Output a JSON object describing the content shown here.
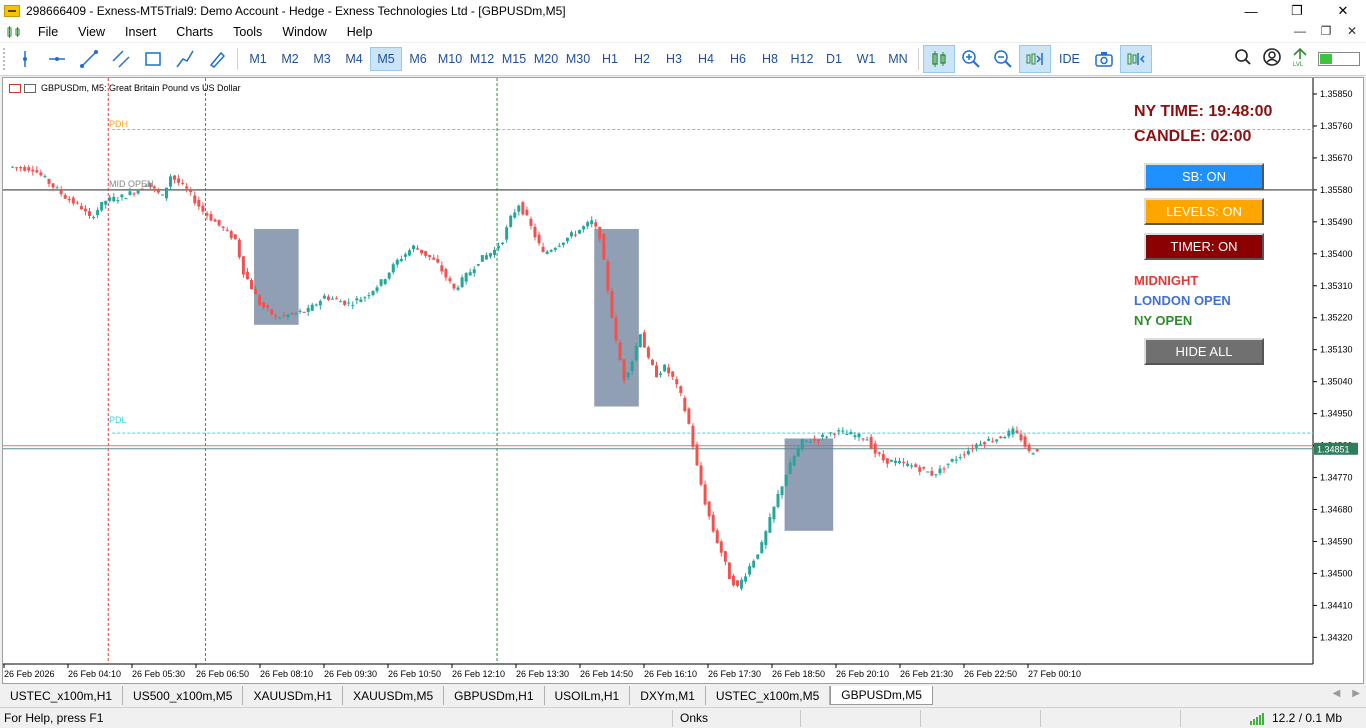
{
  "title_bar": {
    "title": "298666409 - Exness-MT5Trial9: Demo Account - Hedge - Exness Technologies Ltd - [GBPUSDm,M5]",
    "minimize": "—",
    "restore": "❐",
    "close": "✕"
  },
  "menu": {
    "items": [
      "File",
      "View",
      "Insert",
      "Charts",
      "Tools",
      "Window",
      "Help"
    ],
    "right_minimize": "—",
    "right_restore": "❐",
    "right_close": "✕"
  },
  "toolbar": {
    "timeframes": [
      "M1",
      "M2",
      "M3",
      "M4",
      "M5",
      "M6",
      "M10",
      "M12",
      "M15",
      "M20",
      "M30",
      "H1",
      "H2",
      "H3",
      "H4",
      "H6",
      "H8",
      "H12",
      "D1",
      "W1",
      "MN"
    ],
    "active_timeframe": "M5",
    "ide_label": "IDE"
  },
  "chart": {
    "header_text": "GBPUSDm, M5:  Great Britain Pound vs US Dollar",
    "ny_time": "NY TIME: 19:48:00",
    "candle": "CANDLE: 02:00",
    "buttons": {
      "sb": "SB: ON",
      "levels": "LEVELS: ON",
      "timer": "TIMER: ON",
      "hide_all": "HIDE ALL"
    },
    "legend": {
      "midnight": "MIDNIGHT",
      "london_open": "LONDON OPEN",
      "ny_open": "NY OPEN"
    },
    "level_labels": {
      "pdh": "PDH",
      "mid_open": "MID OPEN",
      "pdl": "PDL"
    },
    "current_price": "1.34851",
    "colors": {
      "bull": "#26a69a",
      "bear": "#ef5350",
      "midnight_line": "#e53935",
      "london_line": "#3f6fd8",
      "ny_line": "#2e8b2e",
      "pdh": "#f5a623",
      "pdl": "#33d6e0",
      "zone": "#6b7f99",
      "sb_button": "#1e90ff",
      "levels_button": "#ffa500",
      "timer_button": "#8b0000",
      "hide_button": "#707070"
    }
  },
  "chart_data": {
    "type": "candlestick",
    "symbol": "GBPUSDm",
    "timeframe": "M5",
    "y_ticks": [
      "1.35850",
      "1.35760",
      "1.35670",
      "1.35580",
      "1.35490",
      "1.35400",
      "1.35310",
      "1.35220",
      "1.35130",
      "1.35040",
      "1.34950",
      "1.34860",
      "1.34770",
      "1.34680",
      "1.34590",
      "1.34500",
      "1.34410",
      "1.34320"
    ],
    "ylim": [
      1.34245,
      1.35895
    ],
    "x_ticks": [
      "26 Feb 2026",
      "26 Feb 04:10",
      "26 Feb 05:30",
      "26 Feb 06:50",
      "26 Feb 08:10",
      "26 Feb 09:30",
      "26 Feb 10:50",
      "26 Feb 12:10",
      "26 Feb 13:30",
      "26 Feb 14:50",
      "26 Feb 16:10",
      "26 Feb 17:30",
      "26 Feb 18:50",
      "26 Feb 20:10",
      "26 Feb 21:30",
      "26 Feb 22:50",
      "27 Feb 00:10"
    ],
    "levels": {
      "pdh": 1.3575,
      "mid_open": 1.3558,
      "pdl": 1.34895,
      "current": 1.34851
    },
    "close_path": [
      [
        0,
        1.35645
      ],
      [
        6,
        1.3564
      ],
      [
        10,
        1.356
      ],
      [
        14,
        1.3556
      ],
      [
        18,
        1.3553
      ],
      [
        20,
        1.355
      ],
      [
        24,
        1.3555
      ],
      [
        28,
        1.3556
      ],
      [
        32,
        1.3558
      ],
      [
        34,
        1.356
      ],
      [
        38,
        1.3556
      ],
      [
        40,
        1.3562
      ],
      [
        44,
        1.3558
      ],
      [
        48,
        1.3552
      ],
      [
        52,
        1.3548
      ],
      [
        56,
        1.3544
      ],
      [
        58,
        1.3535
      ],
      [
        62,
        1.3526
      ],
      [
        66,
        1.3522
      ],
      [
        70,
        1.3523
      ],
      [
        74,
        1.3524
      ],
      [
        78,
        1.3528
      ],
      [
        84,
        1.3526
      ],
      [
        88,
        1.3528
      ],
      [
        92,
        1.3532
      ],
      [
        96,
        1.3538
      ],
      [
        100,
        1.3542
      ],
      [
        104,
        1.3539
      ],
      [
        106,
        1.3537
      ],
      [
        110,
        1.353
      ],
      [
        114,
        1.3535
      ],
      [
        116,
        1.3538
      ],
      [
        120,
        1.3541
      ],
      [
        122,
        1.3544
      ],
      [
        124,
        1.355
      ],
      [
        126,
        1.3554
      ],
      [
        128,
        1.355
      ],
      [
        130,
        1.3545
      ],
      [
        132,
        1.354
      ],
      [
        136,
        1.3543
      ],
      [
        140,
        1.3546
      ],
      [
        144,
        1.3549
      ],
      [
        146,
        1.3545
      ],
      [
        148,
        1.353
      ],
      [
        150,
        1.3515
      ],
      [
        152,
        1.3505
      ],
      [
        154,
        1.351
      ],
      [
        156,
        1.3518
      ],
      [
        158,
        1.351
      ],
      [
        160,
        1.3506
      ],
      [
        162,
        1.3508
      ],
      [
        164,
        1.3505
      ],
      [
        166,
        1.35
      ],
      [
        168,
        1.3492
      ],
      [
        170,
        1.348
      ],
      [
        172,
        1.347
      ],
      [
        174,
        1.3462
      ],
      [
        176,
        1.3456
      ],
      [
        178,
        1.3449
      ],
      [
        180,
        1.3446
      ],
      [
        182,
        1.345
      ],
      [
        184,
        1.3454
      ],
      [
        186,
        1.3458
      ],
      [
        188,
        1.3465
      ],
      [
        190,
        1.3472
      ],
      [
        192,
        1.3478
      ],
      [
        194,
        1.3483
      ],
      [
        196,
        1.3487
      ],
      [
        200,
        1.3488
      ],
      [
        204,
        1.349
      ],
      [
        208,
        1.3489
      ],
      [
        212,
        1.3488
      ],
      [
        214,
        1.3484
      ],
      [
        216,
        1.3482
      ],
      [
        220,
        1.3481
      ],
      [
        224,
        1.348
      ],
      [
        228,
        1.3478
      ],
      [
        230,
        1.3479
      ],
      [
        232,
        1.3481
      ],
      [
        236,
        1.3484
      ],
      [
        240,
        1.3487
      ],
      [
        244,
        1.3488
      ],
      [
        248,
        1.349
      ],
      [
        250,
        1.3488
      ],
      [
        252,
        1.3484
      ],
      [
        254,
        1.34851
      ]
    ],
    "sessions": {
      "midnight_bar": 25,
      "london_bar": 49,
      "ny_bar": 121
    },
    "zones": [
      {
        "from_bar": 61,
        "to_bar": 72,
        "high": 1.3547,
        "low": 1.352
      },
      {
        "from_bar": 145,
        "to_bar": 156,
        "high": 1.3547,
        "low": 1.3497
      },
      {
        "from_bar": 192,
        "to_bar": 204,
        "high": 1.3488,
        "low": 1.3462
      }
    ]
  },
  "tabs": [
    "USTEC_x100m,H1",
    "US500_x100m,M5",
    "XAUUSDm,H1",
    "XAUUSDm,M5",
    "GBPUSDm,H1",
    "USOILm,H1",
    "DXYm,M1",
    "USTEC_x100m,M5",
    "GBPUSDm,M5"
  ],
  "active_tab": "GBPUSDm,M5",
  "status": {
    "help": "For Help, press F1",
    "profile": "Onks",
    "traffic": "12.2 / 0.1 Mb"
  }
}
